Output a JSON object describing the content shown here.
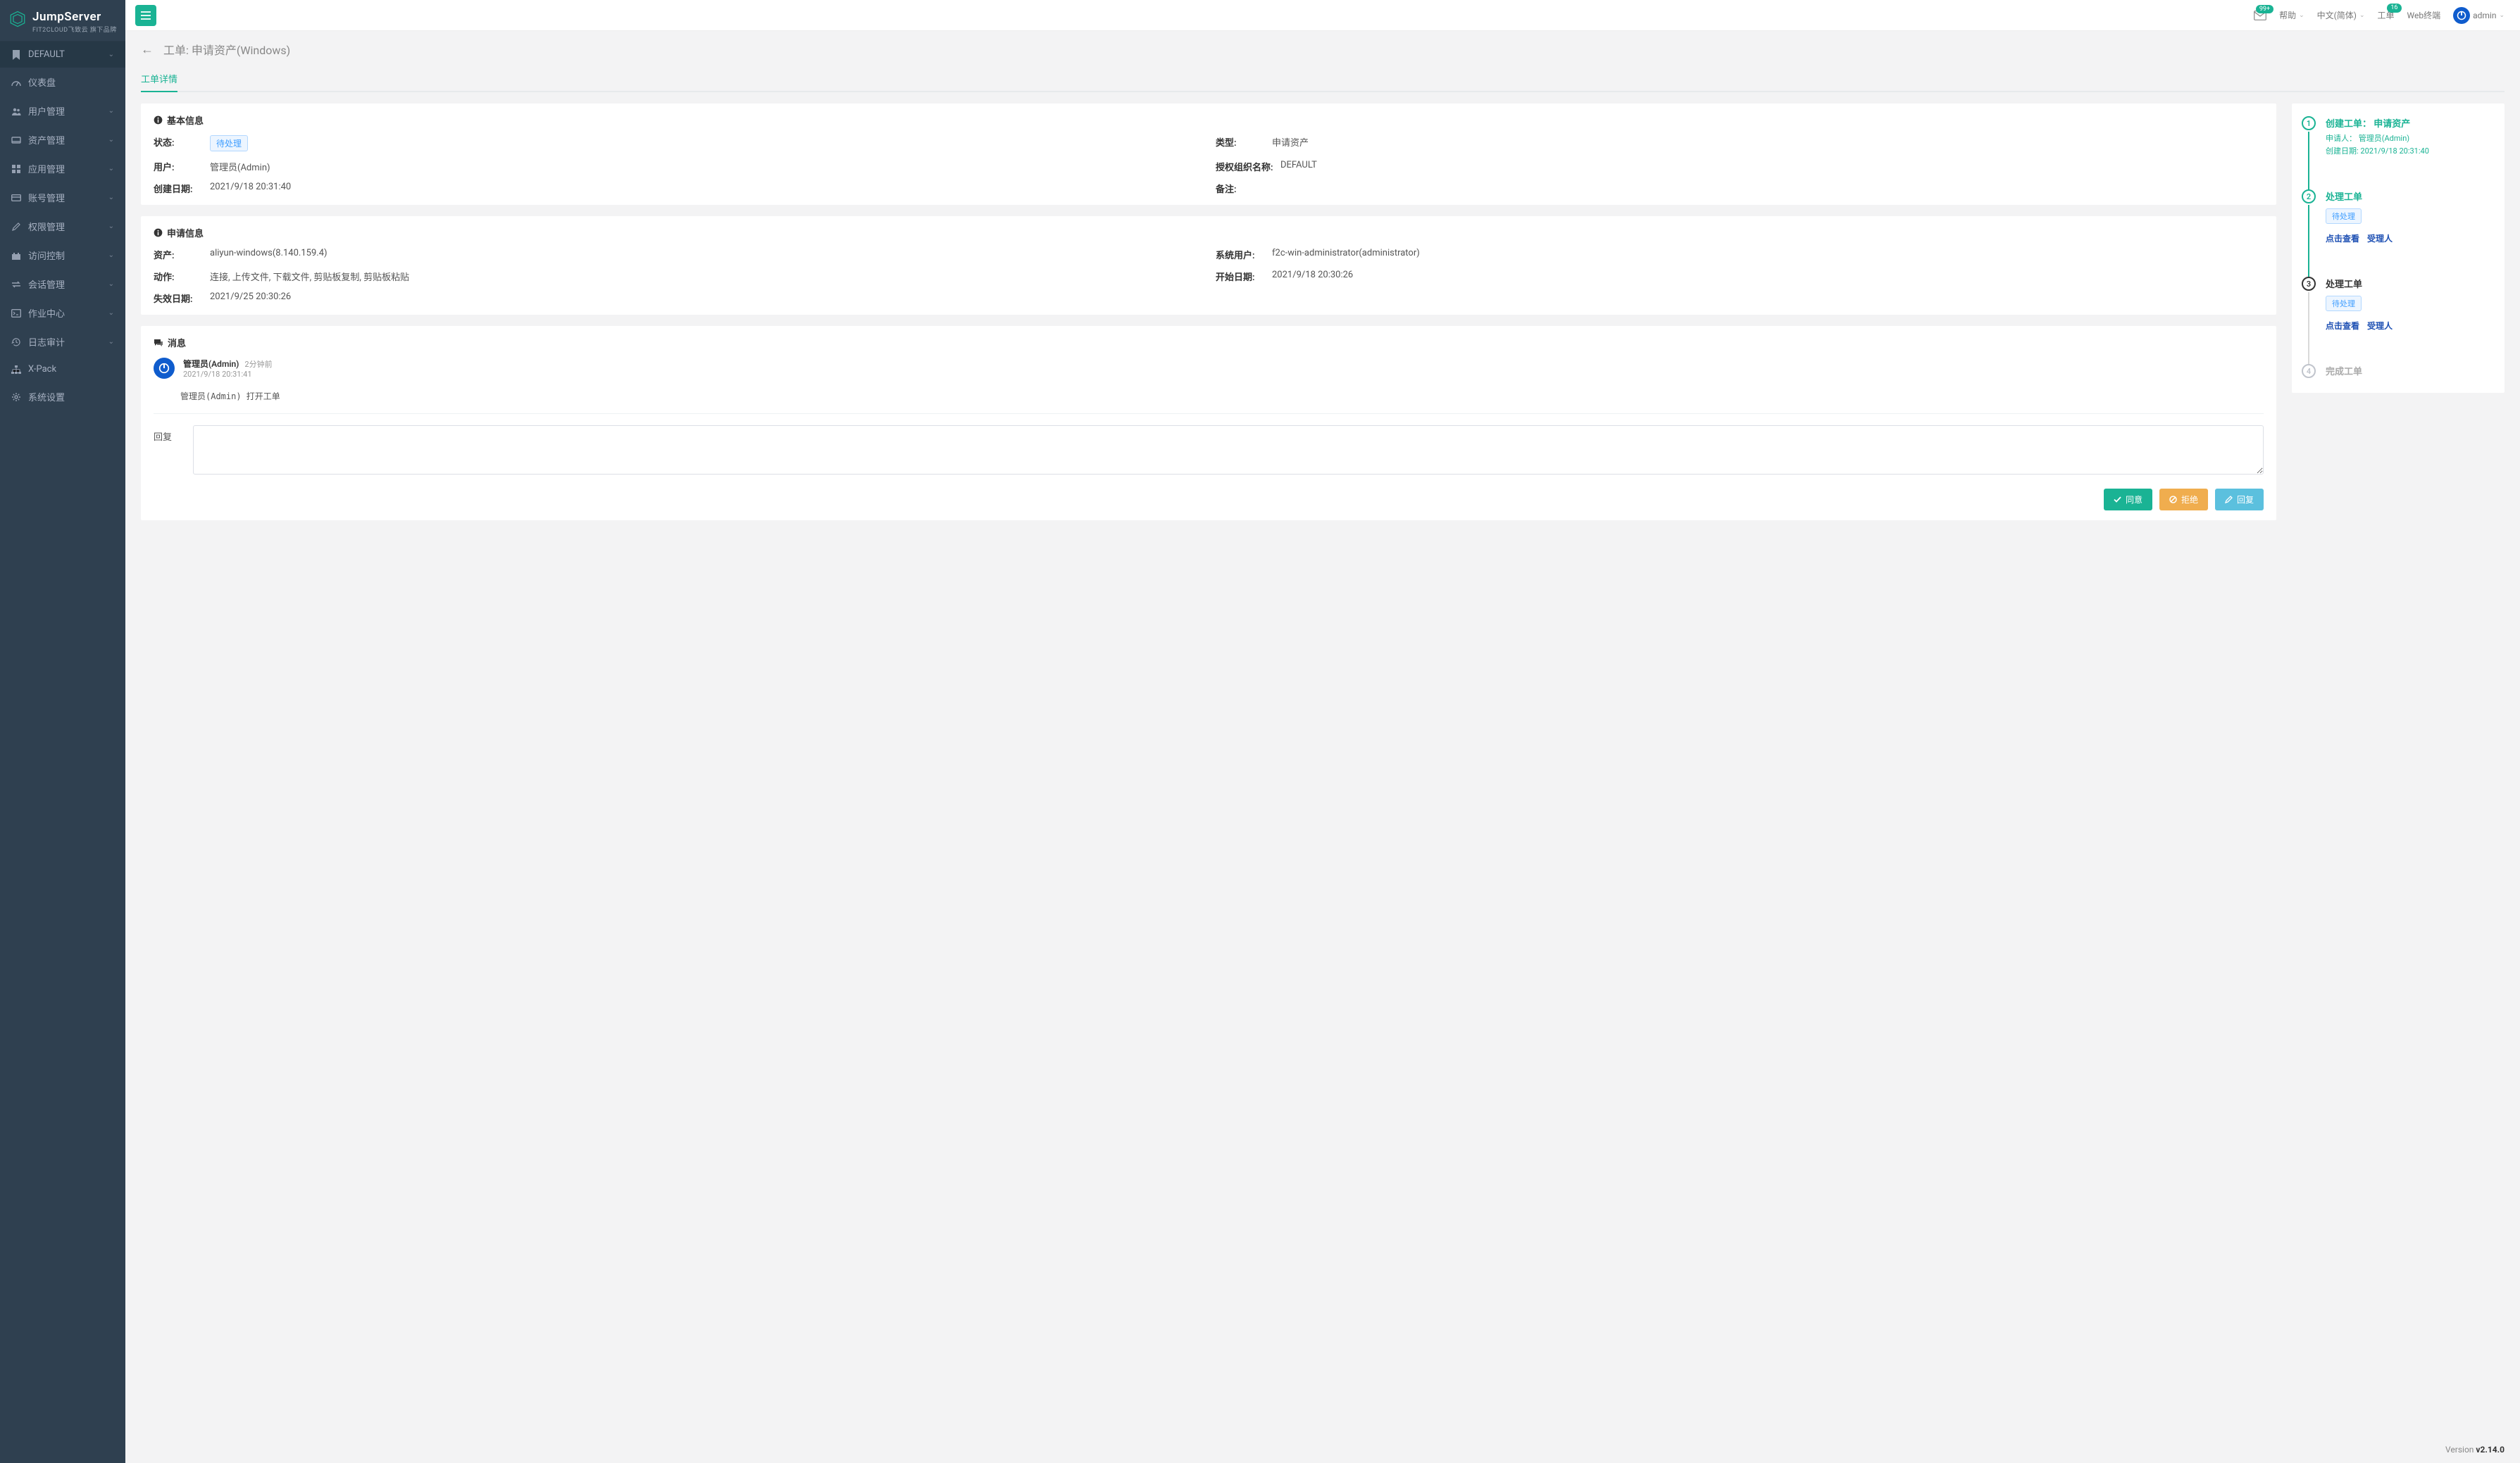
{
  "brand": {
    "title": "JumpServer",
    "subtitle": "FIT2CLOUD飞致云 旗下品牌"
  },
  "sidebar": {
    "org": "DEFAULT",
    "items": [
      {
        "label": "仪表盘",
        "expandable": false
      },
      {
        "label": "用户管理",
        "expandable": true
      },
      {
        "label": "资产管理",
        "expandable": true
      },
      {
        "label": "应用管理",
        "expandable": true
      },
      {
        "label": "账号管理",
        "expandable": true
      },
      {
        "label": "权限管理",
        "expandable": true
      },
      {
        "label": "访问控制",
        "expandable": true
      },
      {
        "label": "会话管理",
        "expandable": true
      },
      {
        "label": "作业中心",
        "expandable": true
      },
      {
        "label": "日志审计",
        "expandable": true
      },
      {
        "label": "X-Pack",
        "expandable": false
      },
      {
        "label": "系统设置",
        "expandable": false
      }
    ]
  },
  "topbar": {
    "mail_badge": "99+",
    "help": "帮助",
    "lang": "中文(简体)",
    "tickets": "工单",
    "tickets_badge": "16",
    "webterm": "Web终端",
    "user": "admin"
  },
  "page": {
    "title": "工单: 申请资产(Windows)",
    "tab": "工单详情"
  },
  "basic": {
    "section_title": "基本信息",
    "status_label": "状态:",
    "status_value": "待处理",
    "type_label": "类型:",
    "type_value": "申请资产",
    "user_label": "用户:",
    "user_value": "管理员(Admin)",
    "org_label": "授权组织名称:",
    "org_value": "DEFAULT",
    "created_label": "创建日期:",
    "created_value": "2021/9/18 20:31:40",
    "remark_label": "备注:",
    "remark_value": ""
  },
  "apply": {
    "section_title": "申请信息",
    "asset_label": "资产:",
    "asset_value": "aliyun-windows(8.140.159.4)",
    "sysuser_label": "系统用户:",
    "sysuser_value": "f2c-win-administrator(administrator)",
    "action_label": "动作:",
    "action_value": "连接, 上传文件, 下载文件, 剪贴板复制, 剪贴板粘贴",
    "start_label": "开始日期:",
    "start_value": "2021/9/18 20:30:26",
    "expire_label": "失效日期:",
    "expire_value": "2021/9/25 20:30:26"
  },
  "messages": {
    "section_title": "消息",
    "items": [
      {
        "name": "管理员(Admin)",
        "rel_time": "2分钟前",
        "abs_time": "2021/9/18 20:31:41",
        "content": "管理员(Admin)  打开工单"
      }
    ],
    "reply_label": "回复",
    "approve_btn": "同意",
    "reject_btn": "拒绝",
    "reply_btn": "回复"
  },
  "timeline": {
    "steps": [
      {
        "title": "创建工单： 申请资产",
        "line1": "申请人： 管理员(Admin)",
        "line2": "创建日期: 2021/9/18 20:31:40"
      },
      {
        "title": "处理工单",
        "status": "待处理",
        "link_view": "点击查看",
        "link_assignee": "受理人"
      },
      {
        "title": "处理工单",
        "status": "待处理",
        "link_view": "点击查看",
        "link_assignee": "受理人"
      },
      {
        "title": "完成工单"
      }
    ]
  },
  "footer": {
    "version_label": "Version",
    "version": "v2.14.0"
  }
}
